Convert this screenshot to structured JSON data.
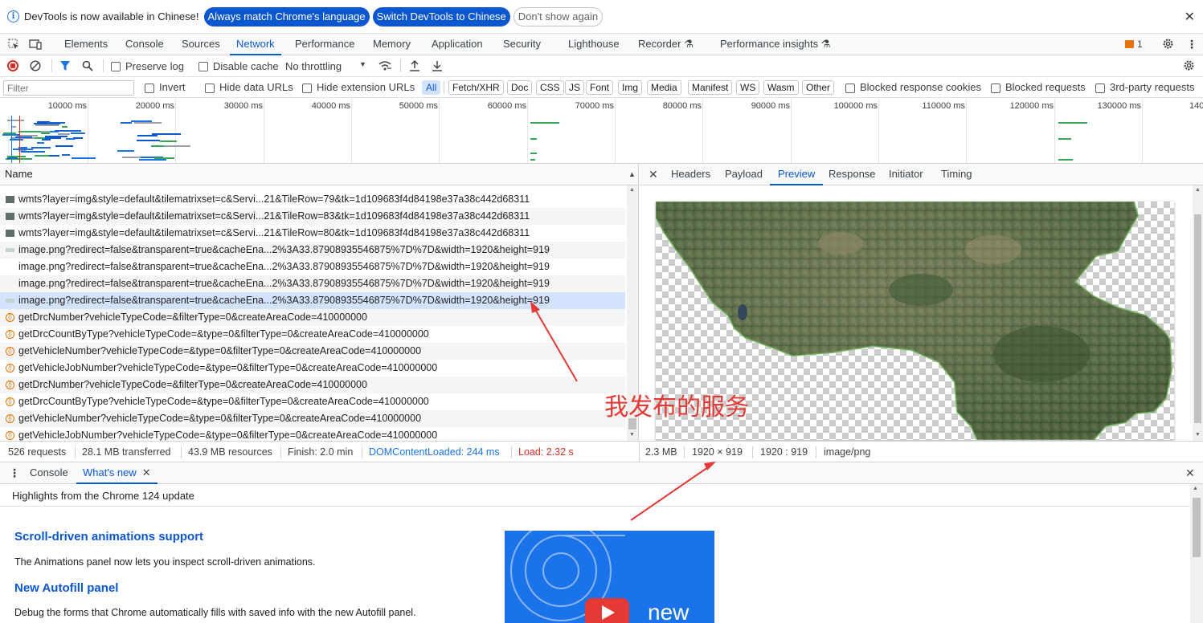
{
  "infobar": {
    "message": "DevTools is now available in Chinese!",
    "btn_match": "Always match Chrome's language",
    "btn_switch": "Switch DevTools to Chinese",
    "btn_dismiss": "Don't show again"
  },
  "main_tabs": [
    "Elements",
    "Console",
    "Sources",
    "Network",
    "Performance",
    "Memory",
    "Application",
    "Security",
    "Lighthouse",
    "Recorder",
    "Performance insights"
  ],
  "active_main_tab": "Network",
  "issues_count": "1",
  "toolbar": {
    "preserve_log": "Preserve log",
    "disable_cache": "Disable cache",
    "throttling": "No throttling"
  },
  "filter": {
    "placeholder": "Filter",
    "invert": "Invert",
    "hide_data_urls": "Hide data URLs",
    "hide_ext_urls": "Hide extension URLs",
    "types": [
      "All",
      "Fetch/XHR",
      "Doc",
      "CSS",
      "JS",
      "Font",
      "Img",
      "Media",
      "Manifest",
      "WS",
      "Wasm",
      "Other"
    ],
    "blocked_cookies": "Blocked response cookies",
    "blocked_requests": "Blocked requests",
    "third_party": "3rd-party requests"
  },
  "overview_ticks": [
    "10000 ms",
    "20000 ms",
    "30000 ms",
    "40000 ms",
    "50000 ms",
    "60000 ms",
    "70000 ms",
    "80000 ms",
    "90000 ms",
    "100000 ms",
    "110000 ms",
    "120000 ms",
    "130000 ms",
    "140"
  ],
  "request_list": {
    "header": "Name",
    "rows": [
      {
        "name": "wmts?layer=img&style=default&tilematrixset=c&Servi...21&TileRow=79&tk=1d109683f4d84198e37a38c442d68311",
        "type": "img"
      },
      {
        "name": "wmts?layer=img&style=default&tilematrixset=c&Servi...21&TileRow=83&tk=1d109683f4d84198e37a38c442d68311",
        "type": "img"
      },
      {
        "name": "wmts?layer=img&style=default&tilematrixset=c&Servi...21&TileRow=80&tk=1d109683f4d84198e37a38c442d68311",
        "type": "img"
      },
      {
        "name": "image.png?redirect=false&transparent=true&cacheEna...2%3A33.87908935546875%7D%7D&width=1920&height=919",
        "type": "png"
      },
      {
        "name": "image.png?redirect=false&transparent=true&cacheEna...2%3A33.87908935546875%7D%7D&width=1920&height=919",
        "type": "none"
      },
      {
        "name": "image.png?redirect=false&transparent=true&cacheEna...2%3A33.87908935546875%7D%7D&width=1920&height=919",
        "type": "none"
      },
      {
        "name": "image.png?redirect=false&transparent=true&cacheEna...2%3A33.87908935546875%7D%7D&width=1920&height=919",
        "type": "png"
      },
      {
        "name": "getDrcNumber?vehicleTypeCode=&filterType=0&createAreaCode=410000000",
        "type": "xhr"
      },
      {
        "name": "getDrcCountByType?vehicleTypeCode=&type=0&filterType=0&createAreaCode=410000000",
        "type": "xhr"
      },
      {
        "name": "getVehicleNumber?vehicleTypeCode=&type=0&filterType=0&createAreaCode=410000000",
        "type": "xhr"
      },
      {
        "name": "getVehicleJobNumber?vehicleTypeCode=&type=0&filterType=0&createAreaCode=410000000",
        "type": "xhr"
      },
      {
        "name": "getDrcNumber?vehicleTypeCode=&filterType=0&createAreaCode=410000000",
        "type": "xhr"
      },
      {
        "name": "getDrcCountByType?vehicleTypeCode=&type=0&filterType=0&createAreaCode=410000000",
        "type": "xhr"
      },
      {
        "name": "getVehicleNumber?vehicleTypeCode=&type=0&filterType=0&createAreaCode=410000000",
        "type": "xhr"
      },
      {
        "name": "getVehicleJobNumber?vehicleTypeCode=&type=0&filterType=0&createAreaCode=410000000",
        "type": "xhr"
      }
    ],
    "selected_index": 6
  },
  "preview_tabs": [
    "Headers",
    "Payload",
    "Preview",
    "Response",
    "Initiator",
    "Timing"
  ],
  "active_preview_tab": "Preview",
  "status": {
    "requests": "526 requests",
    "transferred": "28.1 MB transferred",
    "resources": "43.9 MB resources",
    "finish": "Finish: 2.0 min",
    "dcl": "DOMContentLoaded: 244 ms",
    "load": "Load: 2.32 s",
    "size": "2.3 MB",
    "dimensions": "1920 × 919",
    "ratio": "1920 : 919",
    "mime": "image/png"
  },
  "colors": {
    "accent": "#0b57d0",
    "dcl": "#1a73e8",
    "load": "#d93025",
    "annotation": "#e53935"
  },
  "drawer": {
    "tabs": [
      "Console",
      "What's new"
    ],
    "active_tab": "What's new",
    "highlights": "Highlights from the Chrome 124 update",
    "items": [
      {
        "title": "Scroll-driven animations support",
        "desc": "The Animations panel now lets you inspect scroll-driven animations."
      },
      {
        "title": "New Autofill panel",
        "desc": "Debug the forms that Chrome automatically fills with saved info with the new Autofill panel."
      }
    ],
    "video_label": "new"
  },
  "annotation": "我发布的服务"
}
